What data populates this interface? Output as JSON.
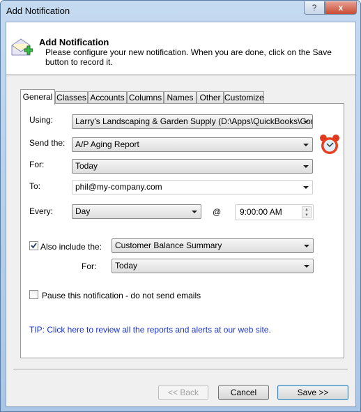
{
  "window": {
    "title": "Add Notification",
    "help": "?",
    "close": "x"
  },
  "header": {
    "title": "Add Notification",
    "description": "Please configure your new notification. When you are done, click on the Save button to record it."
  },
  "tabs": [
    "General",
    "Classes",
    "Accounts",
    "Columns",
    "Names",
    "Other",
    "Customize"
  ],
  "form": {
    "using_label": "Using:",
    "using_value": "Larry's Landscaping & Garden Supply (D:\\Apps\\QuickBooks\\Compa",
    "send_label": "Send the:",
    "send_value": "A/P Aging Report",
    "for_label": "For:",
    "for_value": "Today",
    "to_label": "To:",
    "to_value": "phil@my-company.com",
    "every_label": "Every:",
    "every_value": "Day",
    "at": "@",
    "time_value": "9:00:00 AM",
    "also_label": "Also include the:",
    "also_checked": true,
    "also_value": "Customer Balance Summary",
    "also_for_label": "For:",
    "also_for_value": "Today",
    "pause_label": "Pause this notification - do not send emails",
    "pause_checked": false,
    "tip": "TIP: Click here to review all the reports and alerts at our web site."
  },
  "buttons": {
    "back": "<< Back",
    "cancel": "Cancel",
    "save": "Save >>"
  },
  "colors": {
    "tip": "#1a33cc"
  }
}
